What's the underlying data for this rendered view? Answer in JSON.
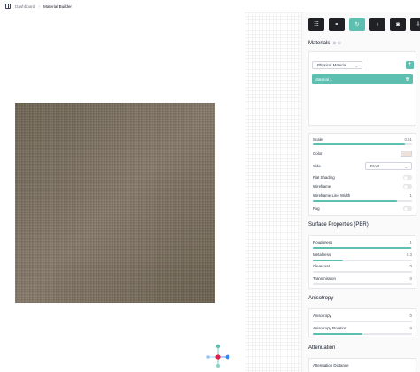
{
  "breadcrumb": {
    "root": "Dashboard",
    "current": "Material Builder"
  },
  "toolbar": [
    {
      "icon": "sliders-icon",
      "glyph": "☷",
      "active": false
    },
    {
      "icon": "link-icon",
      "glyph": "⚭",
      "active": false
    },
    {
      "icon": "refresh-icon",
      "glyph": "↻",
      "active": true
    },
    {
      "icon": "bulb-icon",
      "glyph": "♁",
      "active": false
    },
    {
      "icon": "camera-icon",
      "glyph": "◙",
      "active": false
    },
    {
      "icon": "download-icon",
      "glyph": "⇩",
      "active": false
    }
  ],
  "materials": {
    "title": "Materials",
    "type_select": "Physical Material",
    "add_label": "+",
    "items": [
      {
        "name": "Material 1"
      }
    ]
  },
  "basic": {
    "scale_label": "Scale",
    "scale_value": "0.61",
    "scale_fraction": 0.93,
    "color_label": "Color",
    "color_hex": "#efe3d9",
    "side_label": "Side",
    "side_value": "Front",
    "flat_shading_label": "Flat Shading",
    "flat_shading": false,
    "wireframe_label": "Wireframe",
    "wireframe": false,
    "wire_width_label": "Wireframe Line Width",
    "wire_width_value": "1",
    "wire_width_fraction": 0.85,
    "fog_label": "Fog",
    "fog": false
  },
  "surface": {
    "title": "Surface Properties (PBR)",
    "roughness_label": "Roughness",
    "roughness_value": "1",
    "roughness_fraction": 0.99,
    "metalness_label": "Metalness",
    "metalness_value": "0.3",
    "metalness_fraction": 0.3,
    "clearcoat_label": "Clearcoat",
    "clearcoat_value": "0",
    "clearcoat_fraction": 0.0,
    "transmission_label": "Transmission",
    "transmission_value": "0",
    "transmission_fraction": 0.0
  },
  "anisotropy": {
    "title": "Anisotropy",
    "anisotropy_label": "Anisotropy",
    "anisotropy_value": "0",
    "anisotropy_fraction": 0.0,
    "rotation_label": "Anisotropy Rotation",
    "rotation_value": "0",
    "rotation_fraction": 0.5
  },
  "attenuation": {
    "title": "Attenuation",
    "distance_label": "Attenuation Distance"
  },
  "colors": {
    "accent": "#5cbfb0",
    "toolbar_dark": "#1f2124",
    "material": "#7a6e5f"
  }
}
